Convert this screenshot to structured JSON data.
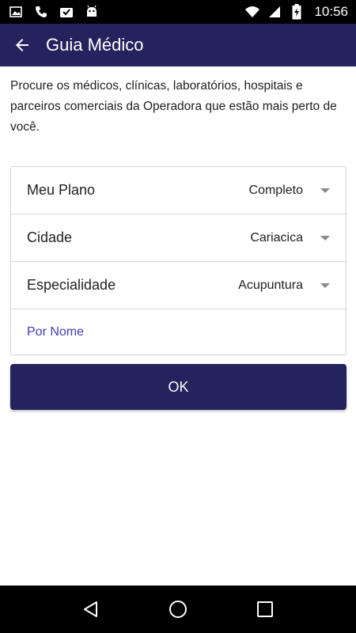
{
  "status_bar": {
    "time": "10:56",
    "left_icons": [
      "image-icon",
      "phone-icon",
      "inbox-check-icon",
      "android-icon"
    ],
    "right_icons": [
      "wifi-icon",
      "signal-icon",
      "battery-charging-icon"
    ]
  },
  "app_bar": {
    "title": "Guia Médico",
    "background": "#25235e"
  },
  "intro_text": "Procure os médicos, clínicas, laboratórios, hospitais e parceiros comerciais da Operadora que estão mais perto de você.",
  "filters": [
    {
      "label": "Meu Plano",
      "value": "Completo"
    },
    {
      "label": "Cidade",
      "value": "Cariacica"
    },
    {
      "label": "Especialidade",
      "value": "Acupuntura"
    }
  ],
  "by_name_link": "Por Nome",
  "ok_button": "OK",
  "colors": {
    "primary": "#25235e",
    "link": "#3f3cb4"
  }
}
